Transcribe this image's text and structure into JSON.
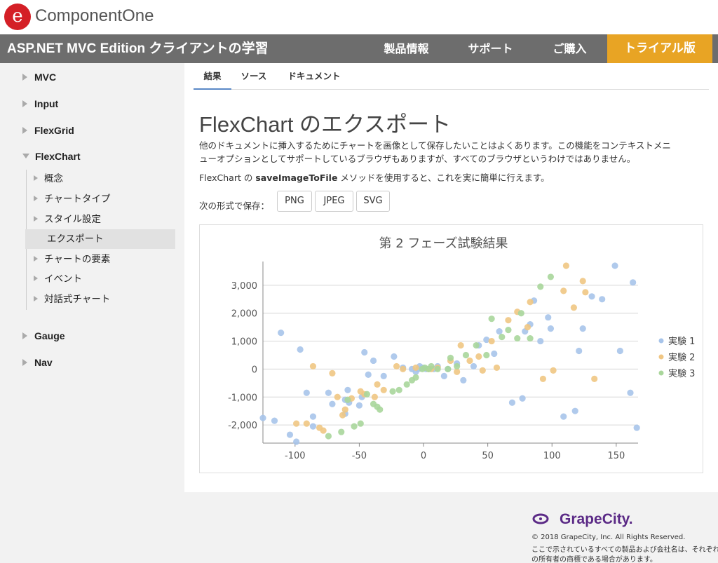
{
  "brand": {
    "name": "ComponentOne",
    "logo_glyph": "e",
    "logo_color": "#d41f26"
  },
  "nav": {
    "title": "ASP.NET MVC Edition クライアントの学習",
    "links": [
      "製品情報",
      "サポート",
      "ご購入"
    ],
    "trial": "トライアル版",
    "bar_color": "#6d6d6d",
    "trial_color": "#e8a424"
  },
  "sidebar": {
    "items": [
      {
        "label": "MVC",
        "expanded": false
      },
      {
        "label": "Input",
        "expanded": false
      },
      {
        "label": "FlexGrid",
        "expanded": false
      },
      {
        "label": "FlexChart",
        "expanded": true
      },
      {
        "label": "Gauge",
        "expanded": false
      },
      {
        "label": "Nav",
        "expanded": false
      }
    ],
    "flexchart_children": [
      "概念",
      "チャートタイプ",
      "スタイル設定",
      "エクスポート",
      "チャートの要素",
      "イベント",
      "対話式チャート"
    ],
    "active_child": "エクスポート"
  },
  "tabs": [
    {
      "label": "結果",
      "active": true
    },
    {
      "label": "ソース",
      "active": false
    },
    {
      "label": "ドキュメント",
      "active": false
    }
  ],
  "content": {
    "title": "FlexChart のエクスポート",
    "para1_line1": "他のドキュメントに挿入するためにチャートを画像として保存したいことはよくあります。この機能をコンテキストメニ",
    "para1_line2": "ューオプションとしてサポートしているブラウザもありますが、すべてのブラウザというわけではありません。",
    "para2_prefix": "FlexChart の ",
    "para2_method": "saveImageToFile",
    "para2_suffix": " メソッドを使用すると、これを実に簡単に行えます。",
    "save_label": "次の形式で保存：",
    "formats": [
      "PNG",
      "JPEG",
      "SVG"
    ]
  },
  "chart_data": {
    "type": "scatter",
    "title": "第 2 フェーズ試験結果",
    "xlim": [
      -125,
      167
    ],
    "ylim": [
      -2650,
      3850
    ],
    "x_ticks": [
      -100,
      -50,
      0,
      50,
      100,
      150
    ],
    "x_tick_labels": [
      "-100",
      "-50",
      "0",
      "50",
      "100",
      "150"
    ],
    "y_ticks": [
      -2000,
      -1000,
      0,
      1000,
      2000,
      3000
    ],
    "y_tick_labels": [
      "-2,000",
      "-1,000",
      "0",
      "1,000",
      "2,000",
      "3,000"
    ],
    "grid": "horizontal",
    "legend_position": "right",
    "series": [
      {
        "name": "実験 1",
        "color": "#a7c4ea",
        "points": [
          [
            -125,
            -1750
          ],
          [
            -116,
            -1850
          ],
          [
            -111,
            1300
          ],
          [
            -104,
            -2350
          ],
          [
            -99,
            -2600
          ],
          [
            -96,
            700
          ],
          [
            -91,
            -850
          ],
          [
            -86,
            -2050
          ],
          [
            -86,
            -1700
          ],
          [
            -74,
            -850
          ],
          [
            -71,
            -1250
          ],
          [
            -61,
            -1600
          ],
          [
            -61,
            -1100
          ],
          [
            -59,
            -750
          ],
          [
            -58,
            -1200
          ],
          [
            -50,
            -1300
          ],
          [
            -48,
            -1000
          ],
          [
            -46,
            600
          ],
          [
            -43,
            -200
          ],
          [
            -39,
            300
          ],
          [
            -31,
            -250
          ],
          [
            -23,
            450
          ],
          [
            -16,
            50
          ],
          [
            -9,
            0
          ],
          [
            -6,
            -100
          ],
          [
            -4,
            0
          ],
          [
            -3,
            100
          ],
          [
            -1,
            50
          ],
          [
            2,
            0
          ],
          [
            8,
            0
          ],
          [
            11,
            100
          ],
          [
            16,
            -250
          ],
          [
            19,
            0
          ],
          [
            26,
            200
          ],
          [
            31,
            -400
          ],
          [
            39,
            100
          ],
          [
            43,
            850
          ],
          [
            49,
            1050
          ],
          [
            55,
            550
          ],
          [
            59,
            1350
          ],
          [
            69,
            -1200
          ],
          [
            77,
            -1050
          ],
          [
            79,
            1350
          ],
          [
            83,
            1600
          ],
          [
            86,
            2450
          ],
          [
            91,
            1000
          ],
          [
            97,
            1850
          ],
          [
            99,
            1450
          ],
          [
            109,
            -1700
          ],
          [
            118,
            -1500
          ],
          [
            121,
            650
          ],
          [
            124,
            1450
          ],
          [
            131,
            2600
          ],
          [
            139,
            2500
          ],
          [
            149,
            3700
          ],
          [
            153,
            650
          ],
          [
            161,
            -850
          ],
          [
            163,
            3100
          ],
          [
            166,
            -2100
          ]
        ]
      },
      {
        "name": "実験 2",
        "color": "#f0c683",
        "points": [
          [
            -99,
            -1950
          ],
          [
            -91,
            -1950
          ],
          [
            -86,
            100
          ],
          [
            -81,
            -2100
          ],
          [
            -78,
            -2200
          ],
          [
            -71,
            -150
          ],
          [
            -67,
            -1000
          ],
          [
            -63,
            -1650
          ],
          [
            -61,
            -1450
          ],
          [
            -56,
            -1050
          ],
          [
            -49,
            -800
          ],
          [
            -46,
            -900
          ],
          [
            -38,
            -1000
          ],
          [
            -36,
            -550
          ],
          [
            -31,
            -750
          ],
          [
            -21,
            100
          ],
          [
            -16,
            0
          ],
          [
            -6,
            50
          ],
          [
            4,
            0
          ],
          [
            6,
            0
          ],
          [
            11,
            50
          ],
          [
            21,
            300
          ],
          [
            26,
            -100
          ],
          [
            29,
            850
          ],
          [
            36,
            300
          ],
          [
            43,
            450
          ],
          [
            46,
            -50
          ],
          [
            53,
            1000
          ],
          [
            57,
            50
          ],
          [
            66,
            1750
          ],
          [
            73,
            2050
          ],
          [
            81,
            1500
          ],
          [
            83,
            2400
          ],
          [
            93,
            -350
          ],
          [
            101,
            -50
          ],
          [
            109,
            2800
          ],
          [
            111,
            3700
          ],
          [
            117,
            2200
          ],
          [
            124,
            3150
          ],
          [
            126,
            2750
          ],
          [
            133,
            -350
          ]
        ]
      },
      {
        "name": "実験 3",
        "color": "#a9d69b",
        "points": [
          [
            -74,
            -2400
          ],
          [
            -64,
            -2250
          ],
          [
            -59,
            -1100
          ],
          [
            -54,
            -2050
          ],
          [
            -49,
            -1950
          ],
          [
            -44,
            -900
          ],
          [
            -39,
            -1250
          ],
          [
            -36,
            -1350
          ],
          [
            -34,
            -1450
          ],
          [
            -24,
            -800
          ],
          [
            -19,
            -750
          ],
          [
            -13,
            -550
          ],
          [
            -9,
            -400
          ],
          [
            -6,
            -300
          ],
          [
            -1,
            0
          ],
          [
            1,
            50
          ],
          [
            4,
            0
          ],
          [
            6,
            100
          ],
          [
            11,
            0
          ],
          [
            19,
            0
          ],
          [
            21,
            400
          ],
          [
            26,
            100
          ],
          [
            33,
            500
          ],
          [
            41,
            850
          ],
          [
            49,
            500
          ],
          [
            53,
            1800
          ],
          [
            61,
            1150
          ],
          [
            66,
            1400
          ],
          [
            73,
            1100
          ],
          [
            76,
            2000
          ],
          [
            83,
            1100
          ],
          [
            91,
            2950
          ],
          [
            99,
            3300
          ]
        ]
      }
    ]
  },
  "footer": {
    "logo_text": "GrapeCity.",
    "line1": "© 2018 GrapeCity, Inc. All Rights Reserved.",
    "line2": "ここで示されているすべての製品および会社名は、それぞれ",
    "line3": "の所有者の商標である場合があります。"
  }
}
